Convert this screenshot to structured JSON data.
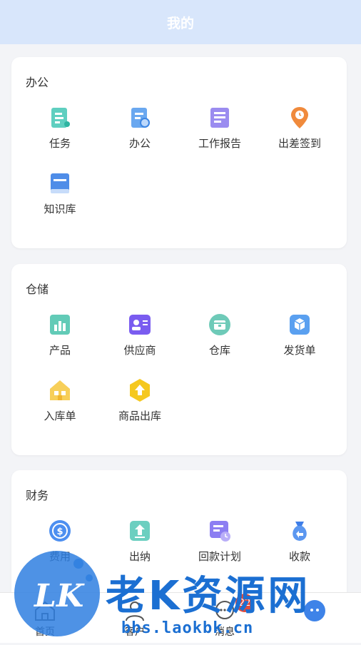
{
  "header": {
    "title": "我的"
  },
  "sections": [
    {
      "title": "办公",
      "items": [
        {
          "label": "任务",
          "icon": "task-doc-icon"
        },
        {
          "label": "办公",
          "icon": "office-doc-search-icon"
        },
        {
          "label": "工作报告",
          "icon": "work-report-icon"
        },
        {
          "label": "出差签到",
          "icon": "location-pin-icon"
        },
        {
          "label": "知识库",
          "icon": "knowledge-book-icon"
        }
      ]
    },
    {
      "title": "仓储",
      "items": [
        {
          "label": "产品",
          "icon": "product-chart-icon"
        },
        {
          "label": "供应商",
          "icon": "supplier-card-icon"
        },
        {
          "label": "仓库",
          "icon": "warehouse-box-icon"
        },
        {
          "label": "发货单",
          "icon": "shipping-box-icon"
        },
        {
          "label": "入库单",
          "icon": "inbound-house-icon"
        },
        {
          "label": "商品出库",
          "icon": "outbound-arrow-icon"
        }
      ]
    },
    {
      "title": "财务",
      "items": [
        {
          "label": "费用",
          "icon": "expense-coin-icon"
        },
        {
          "label": "出纳",
          "icon": "cashier-upload-icon"
        },
        {
          "label": "回款计划",
          "icon": "payment-plan-icon"
        },
        {
          "label": "收款",
          "icon": "money-bag-icon"
        }
      ]
    }
  ],
  "tabbar": {
    "items": [
      {
        "label": "首页",
        "icon": "home-icon"
      },
      {
        "label": "客户",
        "icon": "user-icon"
      },
      {
        "label": "消息",
        "icon": "chat-icon"
      },
      {
        "label": "",
        "icon": "more-icon"
      }
    ],
    "badge": "22"
  },
  "watermark": {
    "big": "老K资源网",
    "url": "bbs.laokbk.cn",
    "logo": "LK"
  },
  "colors": {
    "header": "#d8e6fb",
    "accent": "#1b6fd2",
    "badge": "#e14b3c"
  }
}
